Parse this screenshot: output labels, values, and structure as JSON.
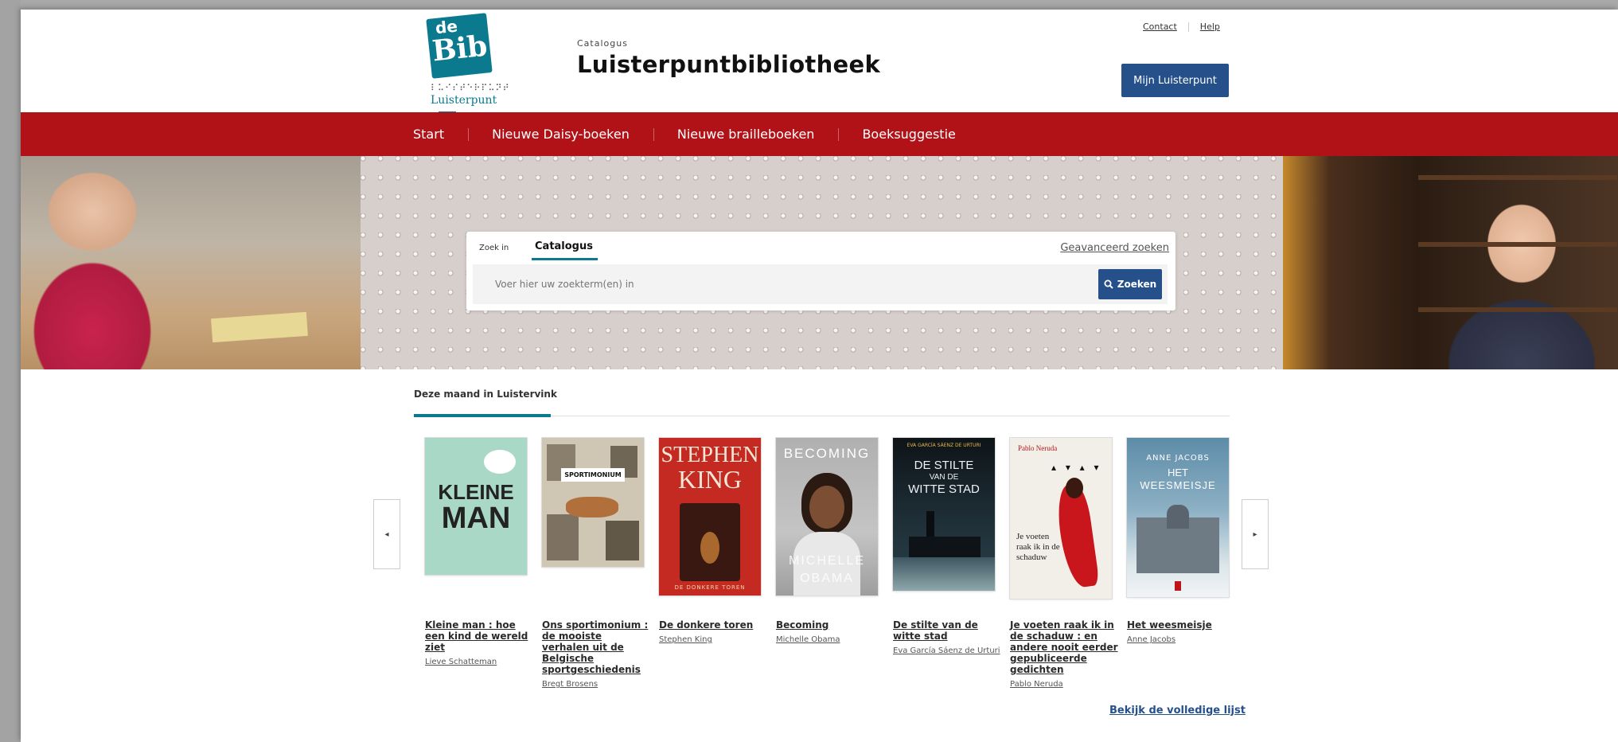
{
  "logo": {
    "top_word": "de",
    "main_word": "Bib",
    "braille": "⠇⠥⠊⠎⠞⠑⠗⠏⠥⠝⠞",
    "name": "Luisterpunt"
  },
  "header": {
    "kicker": "Catalogus",
    "title": "Luisterpuntbibliotheek"
  },
  "utility": {
    "contact": "Contact",
    "help": "Help"
  },
  "account_button": "Mijn Luisterpunt",
  "nav": [
    "Start",
    "Nieuwe Daisy-boeken",
    "Nieuwe brailleboeken",
    "Boeksuggestie"
  ],
  "search": {
    "label": "Zoek in",
    "tab": "Catalogus",
    "advanced": "Geavanceerd zoeken",
    "placeholder": "Voer hier uw zoekterm(en) in",
    "button": "Zoeken"
  },
  "section": {
    "title": "Deze maand in Luistervink",
    "full_list": "Bekijk de volledige lijst"
  },
  "books": [
    {
      "title": "Kleine man : hoe een kind de wereld ziet",
      "author": "Lieve Schatteman",
      "cover_lines": [
        "KLEINE",
        "MAN"
      ],
      "cover_bg": "#a9d8c6"
    },
    {
      "title": "Ons sportimonium : de mooiste verhalen uit de Belgische sportgeschiedenis",
      "author": "Bregt Brosens",
      "cover_lines": [
        "SPORTIMONIUM"
      ],
      "cover_bg": "#cfc6b4"
    },
    {
      "title": "De donkere toren",
      "author": "Stephen King",
      "cover_lines": [
        "STEPHEN",
        "KING",
        "DE DONKERE TOREN"
      ],
      "cover_bg": "#c42a22"
    },
    {
      "title": "Becoming",
      "author": "Michelle Obama",
      "cover_lines": [
        "BECOMING",
        "MICHELLE",
        "OBAMA"
      ],
      "cover_bg": "#b9b9b9"
    },
    {
      "title": "De stilte van de witte stad",
      "author": "Eva García Sáenz de Urturi",
      "cover_lines": [
        "EVA GARCÍA SÁENZ DE URTURI",
        "DE STILTE",
        "VAN DE",
        "WITTE STAD"
      ],
      "cover_bg": "#1c2a34"
    },
    {
      "title": "Je voeten raak ik in de schaduw : en andere nooit eerder gepubliceerde gedichten",
      "author": "Pablo Neruda",
      "cover_lines": [
        "Pablo Neruda",
        "Je voeten raak ik in de schaduw"
      ],
      "cover_bg": "#f2efe9"
    },
    {
      "title": "Het weesmeisje",
      "author": "Anne Jacobs",
      "cover_lines": [
        "ANNE JACOBS",
        "HET",
        "WEESMEISJE"
      ],
      "cover_bg": "#5d8ca8"
    }
  ],
  "colors": {
    "nav_red": "#b01218",
    "primary_blue": "#26508a",
    "teal": "#0b7a8e"
  }
}
